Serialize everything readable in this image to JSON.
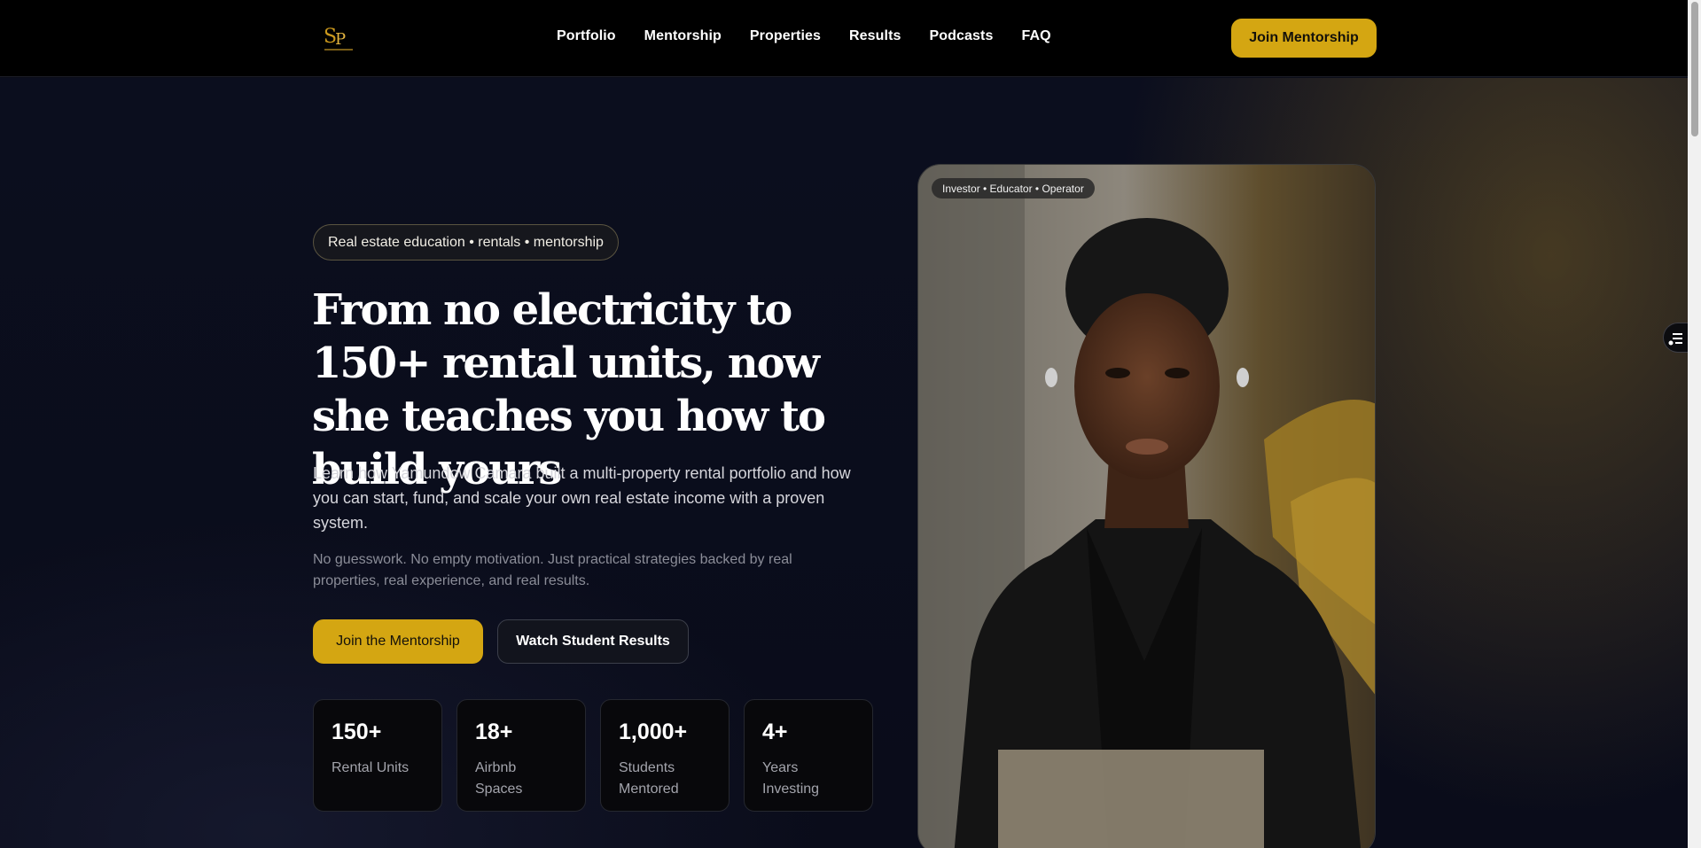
{
  "header": {
    "logo_alt": "SP",
    "nav": [
      "Portfolio",
      "Mentorship",
      "Properties",
      "Results",
      "Podcasts",
      "FAQ"
    ],
    "cta_label": "Join Mentorship"
  },
  "hero": {
    "tag": "Real estate education • rentals • mentorship",
    "headline": "From no electricity to 150+ rental units, now she teaches you how to build yours",
    "lead": "Learn how Yamundow Camara built a multi-property rental portfolio and how you can start, fund, and scale your own real estate income with a proven system.",
    "sub": "No guesswork. No empty motivation. Just practical strategies backed by real properties, real experience, and real results.",
    "primary_cta": "Join the Mentorship",
    "secondary_cta": "Watch Student Results",
    "stats": [
      {
        "value": "150+",
        "label": "Rental Units"
      },
      {
        "value": "18+",
        "label": "Airbnb Spaces"
      },
      {
        "value": "1,000+",
        "label": "Students Mentored"
      },
      {
        "value": "4+",
        "label": "Years Investing"
      }
    ],
    "photo_badge": "Investor • Educator • Operator"
  },
  "colors": {
    "accent": "#d4a612",
    "header_bg": "#000000",
    "hero_bg": "#0a0c1a"
  }
}
